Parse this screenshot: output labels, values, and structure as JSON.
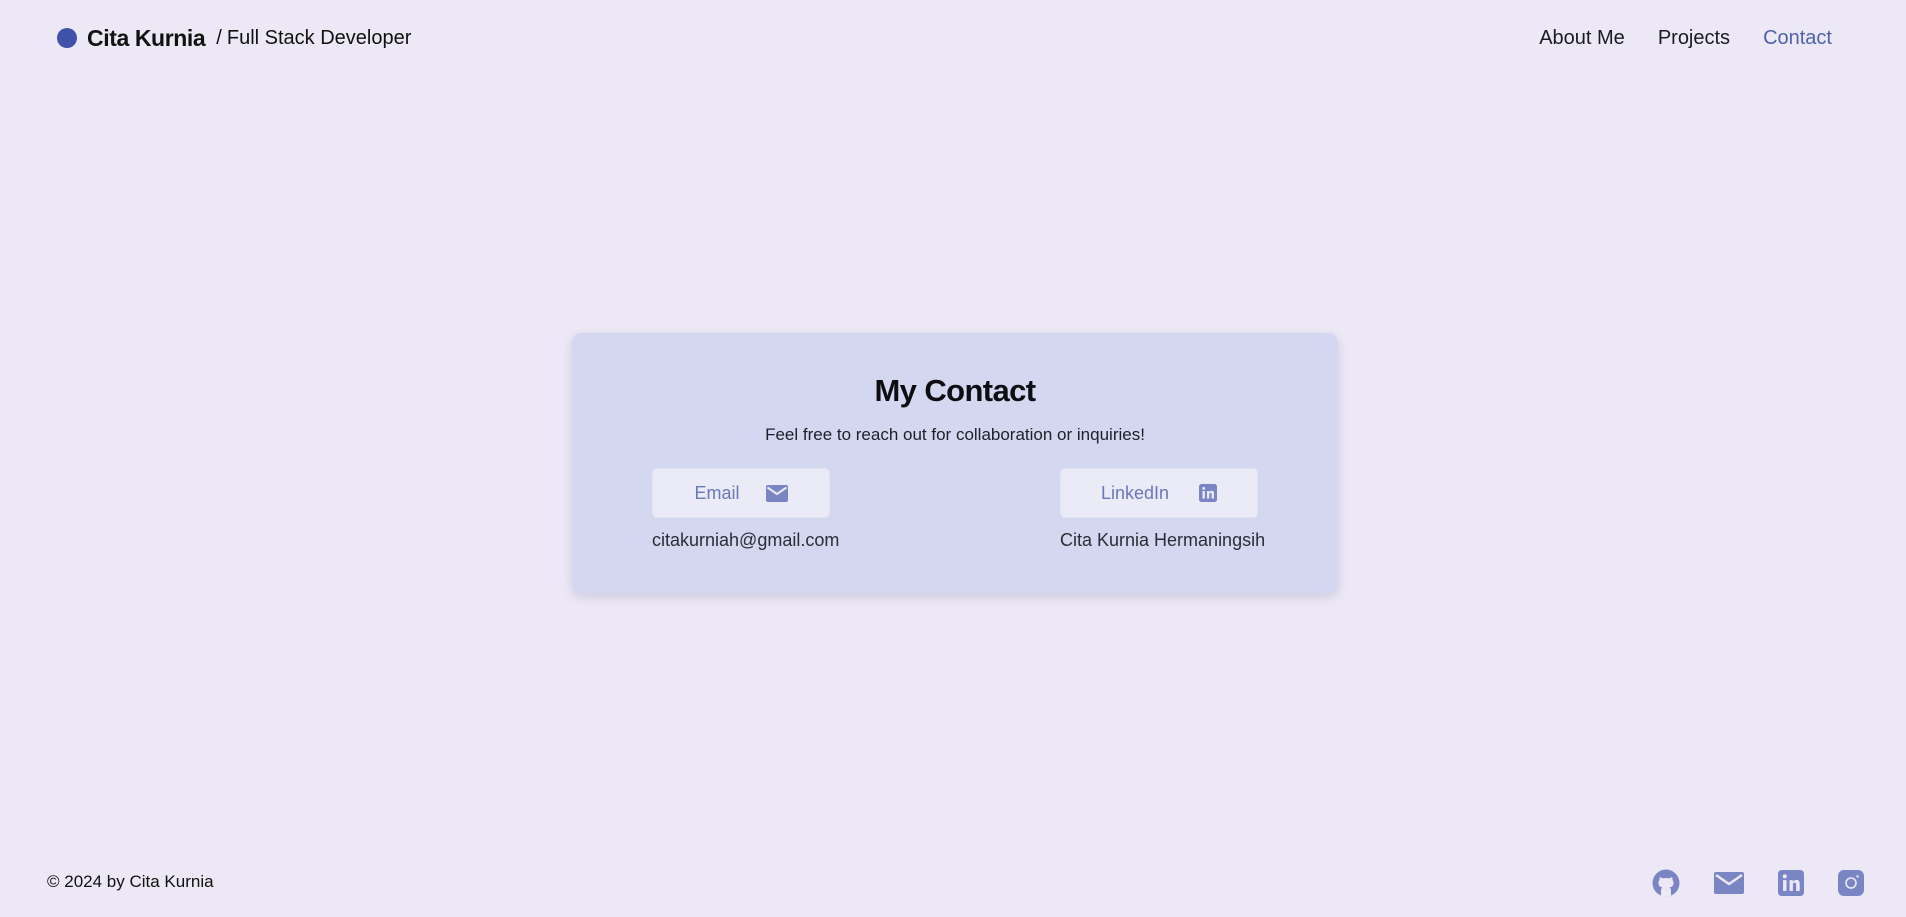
{
  "header": {
    "brand_name": "Cita Kurnia",
    "brand_separator": "/",
    "brand_role": "Full Stack Developer",
    "nav": [
      {
        "label": "About Me",
        "active": false
      },
      {
        "label": "Projects",
        "active": false
      },
      {
        "label": "Contact",
        "active": true
      }
    ]
  },
  "contact": {
    "title": "My Contact",
    "subtitle": "Feel free to reach out for collaboration or inquiries!",
    "email": {
      "label": "Email",
      "icon": "envelope-icon",
      "value": "citakurniah@gmail.com"
    },
    "linkedin": {
      "label": "LinkedIn",
      "icon": "linkedin-icon",
      "value": "Cita Kurnia Hermaningsih"
    }
  },
  "footer": {
    "copyright": "© 2024 by Cita Kurnia",
    "social_icons": [
      "github-icon",
      "envelope-icon",
      "linkedin-icon",
      "instagram-icon"
    ]
  },
  "colors": {
    "background": "#ece8f5",
    "card": "#d3d7f0",
    "accent": "#3f51a8",
    "icon": "#7a86c4",
    "nav_active": "#4f62aa"
  }
}
